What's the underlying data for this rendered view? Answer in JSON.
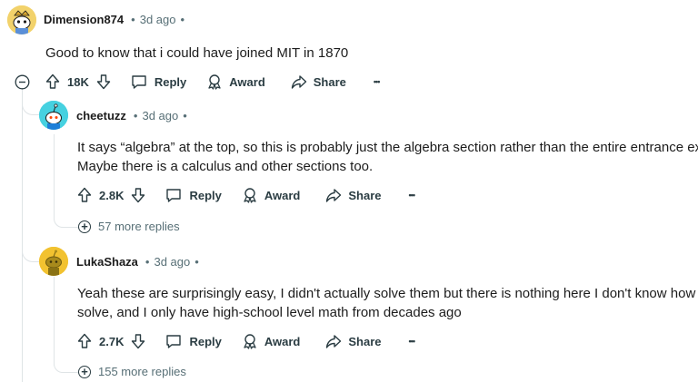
{
  "comments": [
    {
      "username": "Dimension874",
      "time": "3d ago",
      "text_lines": [
        "Good to know that i could have joined MIT in 1870"
      ],
      "score": "18K",
      "reply": "Reply",
      "award": "Award",
      "share": "Share"
    },
    {
      "username": "cheetuzz",
      "time": "3d ago",
      "text_lines": [
        "It says “algebra” at the top, so this is probably just the algebra section rather than the entire entrance ex",
        "Maybe there is a calculus and other sections too."
      ],
      "score": "2.8K",
      "reply": "Reply",
      "award": "Award",
      "share": "Share",
      "more_replies": "57 more replies"
    },
    {
      "username": "LukaShaza",
      "time": "3d ago",
      "text_lines": [
        "Yeah these are surprisingly easy, I didn't actually solve them but there is nothing here I don't know how",
        "solve, and I only have high-school level math from decades ago"
      ],
      "score": "2.7K",
      "reply": "Reply",
      "award": "Award",
      "share": "Share",
      "more_replies": "155 more replies"
    }
  ],
  "separator": "•",
  "more_glyph": "•••",
  "colors": {
    "avatar1": "#f2d26b",
    "avatar2": "#46d1e0",
    "avatar3": "#f2c230",
    "text": "#1c1c1c",
    "meta": "#576f76"
  }
}
